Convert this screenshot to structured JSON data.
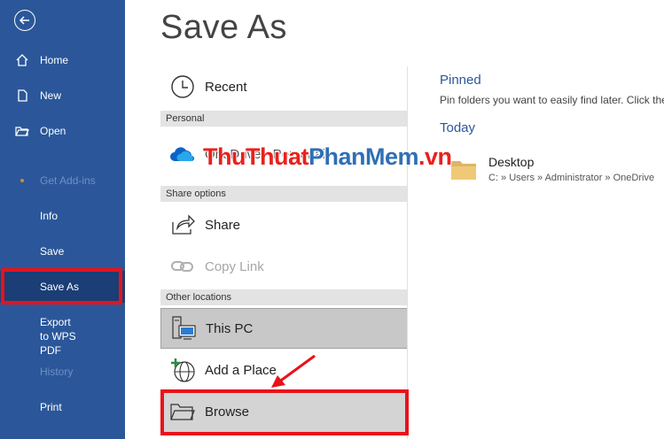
{
  "sidebar": {
    "back_icon": "back-arrow-icon",
    "items": [
      {
        "label": "Home",
        "icon": "home-icon"
      },
      {
        "label": "New",
        "icon": "new-doc-icon"
      },
      {
        "label": "Open",
        "icon": "open-folder-icon"
      },
      {
        "label": "Get Add-ins",
        "icon": "dot-icon"
      },
      {
        "label": "Info"
      },
      {
        "label": "Save"
      },
      {
        "label": "Save As"
      },
      {
        "label": "Export to WPS PDF"
      },
      {
        "label": "History"
      },
      {
        "label": "Print"
      }
    ],
    "bg_color": "#2b579a",
    "active_color": "#1a3e75"
  },
  "main": {
    "title": "Save As",
    "recent_label": "Recent",
    "personal_header": "Personal",
    "onedrive_label": "OneDrive - Personal",
    "share_header": "Share options",
    "share_label": "Share",
    "copy_link_label": "Copy Link",
    "other_header": "Other locations",
    "this_pc_label": "This PC",
    "add_place_label": "Add a Place",
    "browse_label": "Browse"
  },
  "right_panel": {
    "pinned_header": "Pinned",
    "pinned_desc": "Pin folders you want to easily find later. Click the",
    "today_header": "Today",
    "folders": [
      {
        "name": "Desktop",
        "path": "C: » Users » Administrator » OneDrive"
      }
    ]
  },
  "watermark": {
    "part1": "ThuThuat",
    "part2": "PhanMem",
    "part3": ".vn"
  },
  "highlight_color": "#e8121b"
}
